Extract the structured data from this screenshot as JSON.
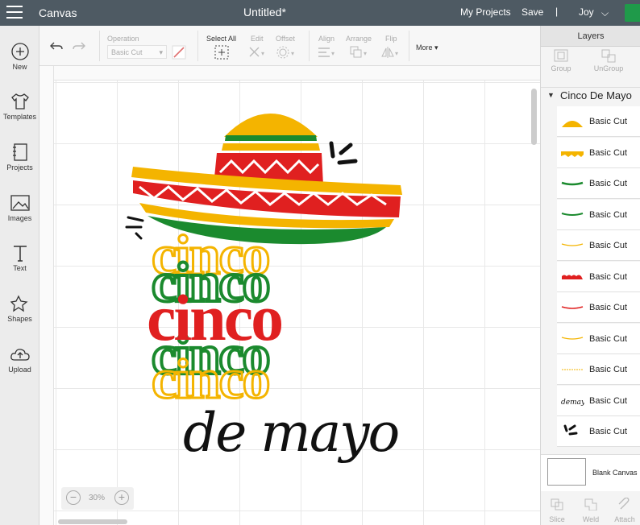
{
  "topbar": {
    "app_name": "Canvas",
    "doc_title": "Untitled*",
    "my_projects": "My Projects",
    "save": "Save",
    "separator": "|",
    "user": "Joy",
    "chevron": "⌵"
  },
  "leftbar": {
    "items": [
      {
        "label": "New",
        "icon": "plus-icon"
      },
      {
        "label": "Templates",
        "icon": "shirt-icon"
      },
      {
        "label": "Projects",
        "icon": "notebook-icon"
      },
      {
        "label": "Images",
        "icon": "image-icon"
      },
      {
        "label": "Text",
        "icon": "text-icon"
      },
      {
        "label": "Shapes",
        "icon": "shapes-icon"
      },
      {
        "label": "Upload",
        "icon": "upload-icon"
      }
    ]
  },
  "toolbar": {
    "operation_label": "Operation",
    "operation_value": "Basic Cut",
    "select_all": "Select All",
    "edit": "Edit",
    "offset": "Offset",
    "align": "Align",
    "arrange": "Arrange",
    "flip": "Flip",
    "more": "More"
  },
  "canvas": {
    "zoom_minus": "−",
    "zoom_value": "30%",
    "zoom_plus": "+",
    "artwork_text": "cinco de mayo"
  },
  "layers_panel": {
    "title": "Layers",
    "group": "Group",
    "ungroup": "UnGroup",
    "group_name": "Cinco De Mayo",
    "layers": [
      {
        "label": "Basic Cut",
        "color": "#f4b400"
      },
      {
        "label": "Basic Cut",
        "color": "#f4b400"
      },
      {
        "label": "Basic Cut",
        "color": "#1b8a2e"
      },
      {
        "label": "Basic Cut",
        "color": "#1b8a2e"
      },
      {
        "label": "Basic Cut",
        "color": "#f4b400"
      },
      {
        "label": "Basic Cut",
        "color": "#e02020"
      },
      {
        "label": "Basic Cut",
        "color": "#e02020"
      },
      {
        "label": "Basic Cut",
        "color": "#f4b400"
      },
      {
        "label": "Basic Cut",
        "color": "#f4b400"
      },
      {
        "label": "Basic Cut",
        "color": "#111111"
      },
      {
        "label": "Basic Cut",
        "color": "#111111"
      }
    ],
    "blank_canvas": "Blank Canvas",
    "slice": "Slice",
    "weld": "Weld",
    "attach": "Attach"
  },
  "colors": {
    "yellow": "#f4b400",
    "red": "#e02020",
    "green": "#1b8a2e",
    "black": "#111111",
    "topbar": "#4e5a63"
  }
}
